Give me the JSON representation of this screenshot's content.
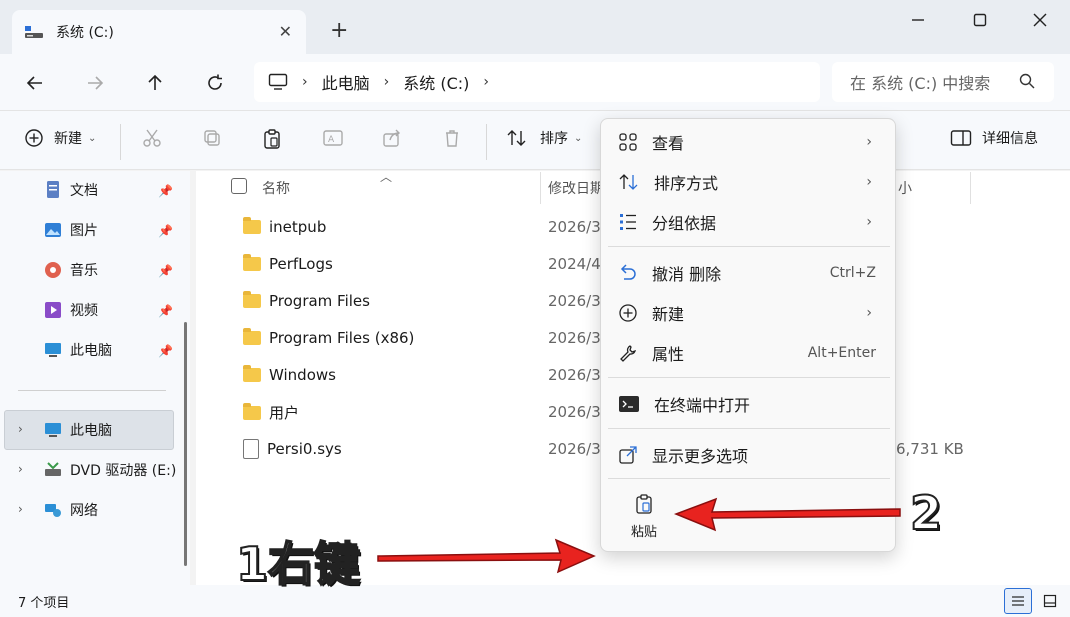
{
  "window": {
    "tab_title": "系统 (C:)",
    "new_tab_symbol": "+"
  },
  "address": {
    "crumbs": [
      "此电脑",
      "系统 (C:)"
    ],
    "search_placeholder": "在 系统 (C:) 中搜索"
  },
  "toolbar": {
    "new_label": "新建",
    "sort_label": "排序",
    "details_label": "详细信息"
  },
  "sidebar": {
    "pinned": [
      {
        "label": "文档"
      },
      {
        "label": "图片"
      },
      {
        "label": "音乐"
      },
      {
        "label": "视频"
      },
      {
        "label": "此电脑"
      }
    ],
    "tree": [
      {
        "label": "此电脑"
      },
      {
        "label": "DVD 驱动器 (E:)"
      },
      {
        "label": "网络"
      }
    ]
  },
  "file_list": {
    "columns": {
      "name": "名称",
      "modified": "修改日期",
      "size": "小"
    },
    "rows": [
      {
        "name": "inetpub",
        "date": "2026/3",
        "type": "folder"
      },
      {
        "name": "PerfLogs",
        "date": "2024/4",
        "type": "folder"
      },
      {
        "name": "Program Files",
        "date": "2026/3",
        "type": "folder"
      },
      {
        "name": "Program Files (x86)",
        "date": "2026/3",
        "type": "folder"
      },
      {
        "name": "Windows",
        "date": "2026/3",
        "type": "folder"
      },
      {
        "name": "用户",
        "date": "2026/3",
        "type": "folder"
      },
      {
        "name": "Persi0.sys",
        "date": "2026/3",
        "type": "file",
        "size": "6,731 KB"
      }
    ]
  },
  "status": {
    "count": "7 个项目"
  },
  "context_menu": {
    "items": [
      {
        "label": "查看",
        "arrow": "›"
      },
      {
        "label": "排序方式",
        "arrow": "›"
      },
      {
        "label": "分组依据",
        "arrow": "›"
      },
      {
        "label": "撤消 删除",
        "shortcut": "Ctrl+Z"
      },
      {
        "label": "新建",
        "arrow": "›"
      },
      {
        "label": "属性",
        "shortcut": "Alt+Enter"
      },
      {
        "label": "在终端中打开"
      },
      {
        "label": "显示更多选项"
      }
    ],
    "paste_label": "粘贴"
  },
  "annotations": {
    "step1": "1右键",
    "step2": "2",
    "arrow_color": "#e8231f"
  }
}
